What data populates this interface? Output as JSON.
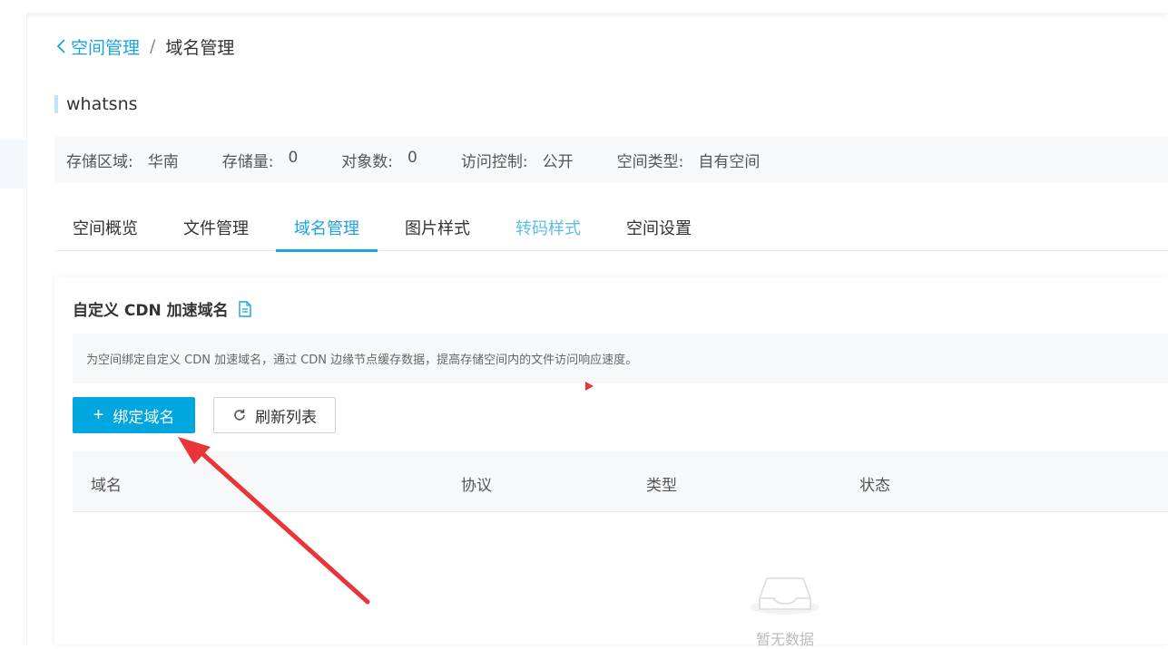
{
  "breadcrumb": {
    "back_label": "空间管理",
    "separator": "/",
    "current": "域名管理"
  },
  "bucket": {
    "name": "whatsns"
  },
  "info": [
    {
      "label": "存储区域:",
      "value": "华南"
    },
    {
      "label": "存储量:",
      "value": "0"
    },
    {
      "label": "对象数:",
      "value": "0"
    },
    {
      "label": "访问控制:",
      "value": "公开"
    },
    {
      "label": "空间类型:",
      "value": "自有空间"
    }
  ],
  "tabs": [
    {
      "label": "空间概览"
    },
    {
      "label": "文件管理"
    },
    {
      "label": "域名管理"
    },
    {
      "label": "图片样式"
    },
    {
      "label": "转码样式"
    },
    {
      "label": "空间设置"
    }
  ],
  "card": {
    "title": "自定义 CDN 加速域名",
    "notice": "为空间绑定自定义 CDN 加速域名，通过 CDN 边缘节点缓存数据，提高存储空间内的文件访问响应速度。",
    "bind_button": "绑定域名",
    "refresh_button": "刷新列表"
  },
  "table": {
    "columns": [
      "域名",
      "协议",
      "类型",
      "状态"
    ]
  },
  "empty": {
    "text": "暂无数据"
  },
  "colors": {
    "accent": "#00a6e0",
    "annotation": "#e8353a"
  },
  "icons": {
    "back": "chevron-left-icon",
    "doc": "document-icon",
    "plus": "plus-icon",
    "refresh": "refresh-icon",
    "empty": "empty-inbox-icon"
  }
}
